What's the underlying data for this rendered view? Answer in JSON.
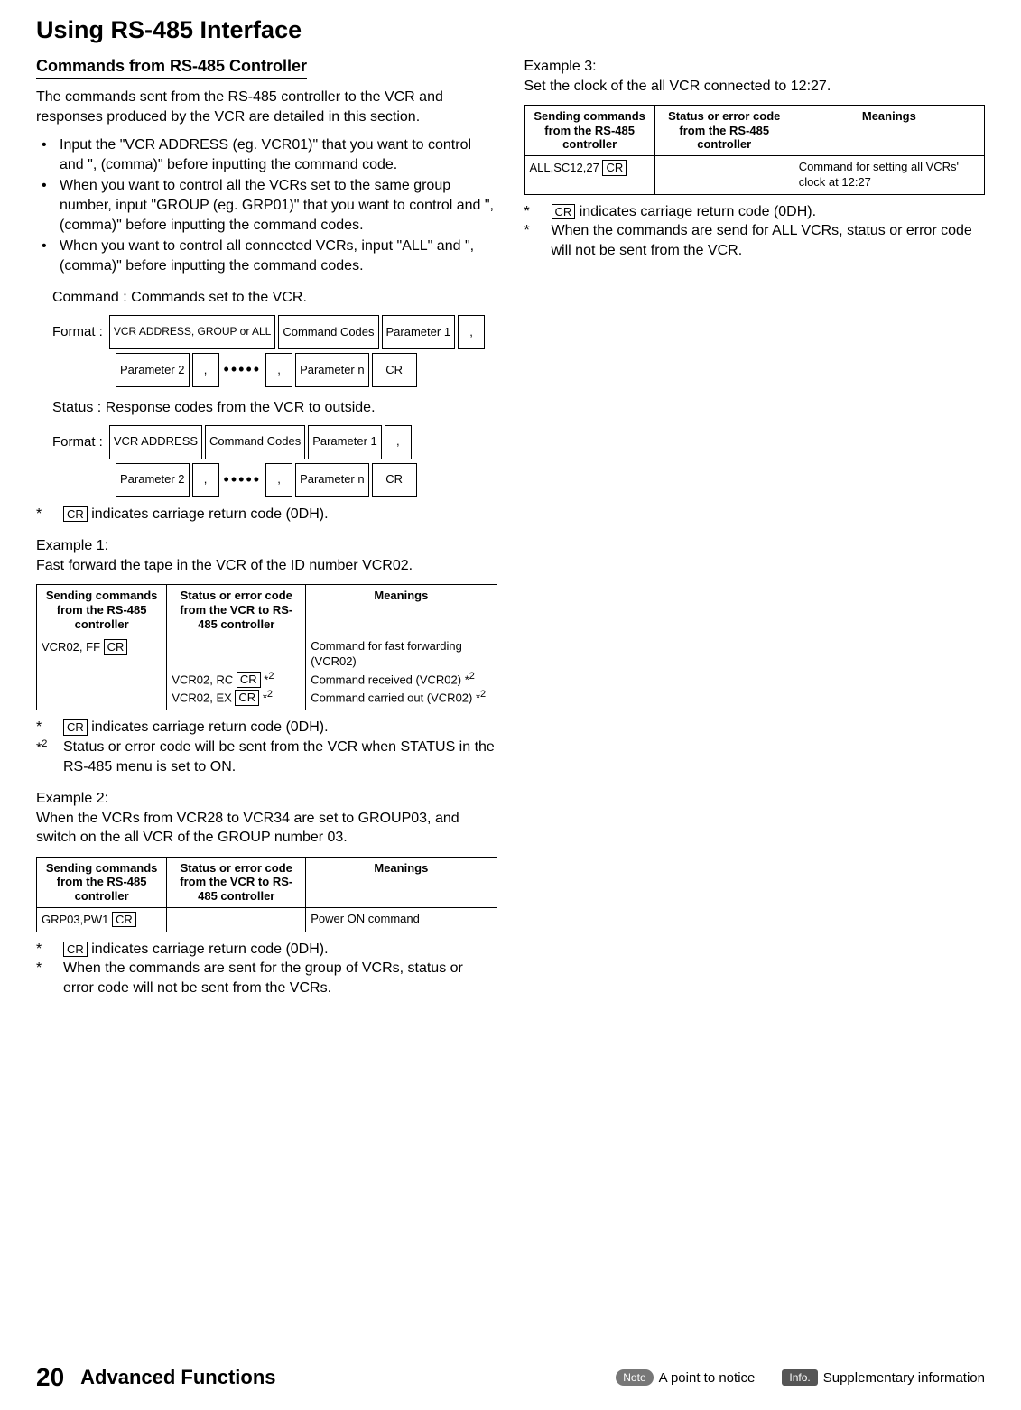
{
  "title": "Using RS-485 Interface",
  "left": {
    "h2": "Commands from RS-485 Controller",
    "intro": "The commands sent from the RS-485 controller to the VCR and responses produced by the VCR are detailed in this section.",
    "bullets": [
      "Input the \"VCR ADDRESS (eg. VCR01)\" that you want to control and \", (comma)\" before inputting the command code.",
      "When you want to control all the VCRs set to the same group number, input \"GROUP (eg. GRP01)\" that you want to control and \", (comma)\" before inputting the command codes.",
      "When you want to control all connected VCRs, input \"ALL\" and \", (comma)\" before inputting the command codes."
    ],
    "command_label": "Command :  Commands set to the VCR.",
    "status_label": "Status  :  Response codes from the VCR to outside.",
    "format_label": "Format :",
    "fmt": {
      "addr_cmd": "VCR ADDRESS, GROUP or ALL",
      "addr_status": "VCR ADDRESS",
      "codes": "Command Codes",
      "p1": "Parameter 1",
      "p2": "Parameter 2",
      "pn": "Parameter n",
      "comma": ",",
      "cr": "CR"
    },
    "note_cr": " indicates carriage return code (0DH).",
    "ex1_title": "Example 1:",
    "ex1_body": "Fast forward the tape in the VCR of the ID number VCR02.",
    "table_headers": {
      "c1": "Sending commands from the RS-485 controller",
      "c2a": "Status or error code from the VCR to RS-485 controller",
      "c2b": "Status or error code from the RS-485 controller",
      "c3": "Meanings"
    },
    "ex1_row": {
      "send": "VCR02, FF ",
      "status_line1": "VCR02, RC ",
      "status_line2": "VCR02, EX ",
      "mean1": "Command for fast forwarding (VCR02)",
      "mean2": "Command received (VCR02) *",
      "mean3": "Command carried out (VCR02) *"
    },
    "ex1_note2": "Status or error code will be sent from the VCR when STATUS in the RS-485 menu is set to ON.",
    "ex2_title": "Example 2:",
    "ex2_body": "When the VCRs from VCR28 to VCR34 are set to GROUP03, and switch on the all VCR of the GROUP number 03.",
    "ex2_row": {
      "send": "GRP03,PW1 ",
      "mean": "Power ON command"
    },
    "ex2_note2": "When the commands are sent for the group of VCRs, status or error code will not be sent from the VCRs."
  },
  "right": {
    "ex3_title": "Example 3:",
    "ex3_body": "Set the clock of the all VCR connected to 12:27.",
    "ex3_row": {
      "send": "ALL,SC12,27 ",
      "mean": "Command for setting all VCRs' clock at 12:27"
    },
    "ex3_note2": "When the commands are send for ALL VCRs, status or error code will not be sent from the VCR."
  },
  "footer": {
    "page": "20",
    "section": "Advanced Functions",
    "note_badge": "Note",
    "note_text": "A point to notice",
    "info_badge": "Info.",
    "info_text": "Supplementary information"
  },
  "cr": "CR",
  "star": "*",
  "star2": "*2",
  "sup2": "2"
}
